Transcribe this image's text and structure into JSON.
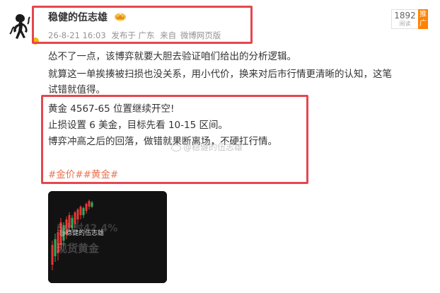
{
  "post": {
    "username": "稳健的伍志雄",
    "meta": {
      "date": "26-8-21 16:03",
      "published": "发布于 广东",
      "source_prefix": "来自",
      "source": "微博网页版"
    },
    "stats": {
      "read_count": "1892",
      "read_label": "阅读",
      "push_label": "推广"
    },
    "lines": [
      "怂不了一点，该博弈就要大胆去验证咱们给出的分析逻辑。",
      "就算这一单挨揍被扫损也没关系，用小代价，换来对后市行情更清晰的认知，这笔",
      "试错就值得。",
      "黄金 4567-65 位置继续开空!",
      "止损设置 6 美金，目标先看 10-15 区间。",
      "博弈冲高之后的回落，做错就果断离场，不硬扛行情。"
    ],
    "tags": [
      "#金价#",
      "#黄金#"
    ],
    "watermark": "@稳健的伍志雄",
    "thumbnail": {
      "caption": "@稳健的伍志雄",
      "overlay_line1": "5小时42.4%",
      "overlay_line2": "现货黄金"
    }
  },
  "colors": {
    "highlight_border": "#e5474f",
    "tag": "#eb7350",
    "push_button": "#ff8200",
    "meta_text": "#939393",
    "chart_up": "#e53935",
    "chart_down": "#2eae5a"
  },
  "icons": [
    "avatar",
    "crown-icon",
    "weibo-watermark-icon"
  ]
}
